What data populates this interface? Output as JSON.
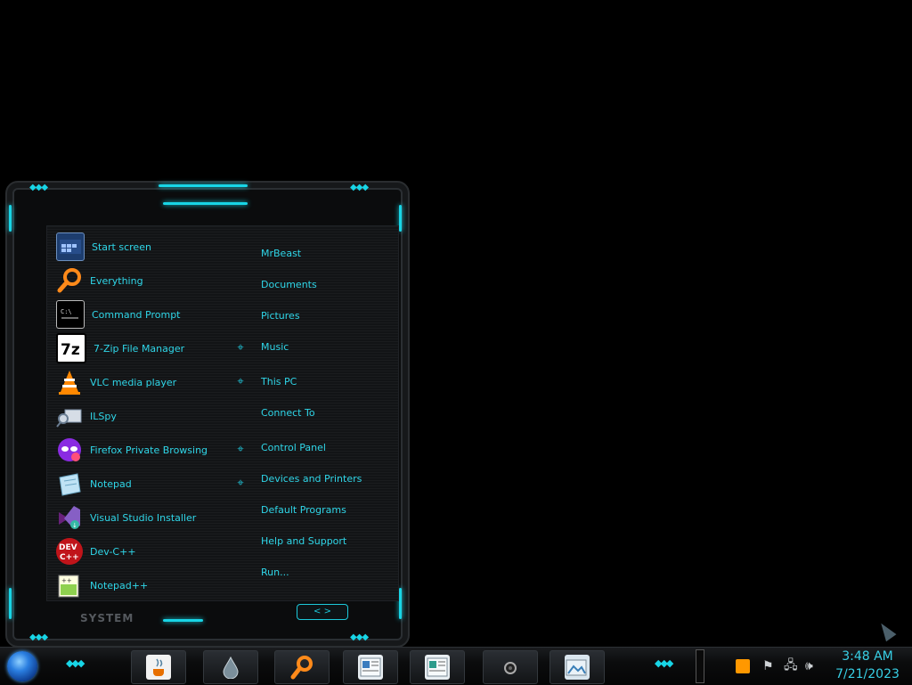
{
  "start_menu": {
    "programs": [
      {
        "label": "Start screen",
        "icon": "start-screen-icon",
        "has_jumplist": false
      },
      {
        "label": "Everything",
        "icon": "magnifier-icon",
        "has_jumplist": false
      },
      {
        "label": "Command Prompt",
        "icon": "cmd-icon",
        "has_jumplist": false
      },
      {
        "label": "7-Zip File Manager",
        "icon": "7zip-icon",
        "has_jumplist": true
      },
      {
        "label": "VLC media player",
        "icon": "vlc-cone-icon",
        "has_jumplist": true
      },
      {
        "label": "ILSpy",
        "icon": "ilspy-icon",
        "has_jumplist": false
      },
      {
        "label": "Firefox Private Browsing",
        "icon": "firefox-private-icon",
        "has_jumplist": true
      },
      {
        "label": "Notepad",
        "icon": "notepad-icon",
        "has_jumplist": true
      },
      {
        "label": "Visual Studio Installer",
        "icon": "vs-installer-icon",
        "has_jumplist": false
      },
      {
        "label": "Dev-C++",
        "icon": "devcpp-icon",
        "has_jumplist": false
      },
      {
        "label": "Notepad++",
        "icon": "notepadpp-icon",
        "has_jumplist": false
      }
    ],
    "places": [
      "MrBeast",
      "Documents",
      "Pictures",
      "Music",
      "This PC",
      "Connect To",
      "Control Panel",
      "Devices and Printers",
      "Default Programs",
      "Help and Support",
      "Run..."
    ],
    "system_label": "SYSTEM",
    "nav_arrows": "< >"
  },
  "taskbar": {
    "pinned": [
      {
        "icon": "java-icon"
      },
      {
        "icon": "water-drop-icon"
      },
      {
        "icon": "magnifier-icon"
      },
      {
        "icon": "newspaper-icon"
      },
      {
        "icon": "document-icon"
      },
      {
        "icon": "camera-icon"
      },
      {
        "icon": "photo-viewer-icon"
      }
    ],
    "tray": {
      "icons": [
        "sublime-icon",
        "flag-icon",
        "network-icon",
        "volume-icon"
      ]
    },
    "clock": {
      "time": "3:48 AM",
      "date": "7/21/2023"
    }
  },
  "colors": {
    "accent": "#18d5e6",
    "text": "#2fd6e8",
    "background": "#000000"
  }
}
